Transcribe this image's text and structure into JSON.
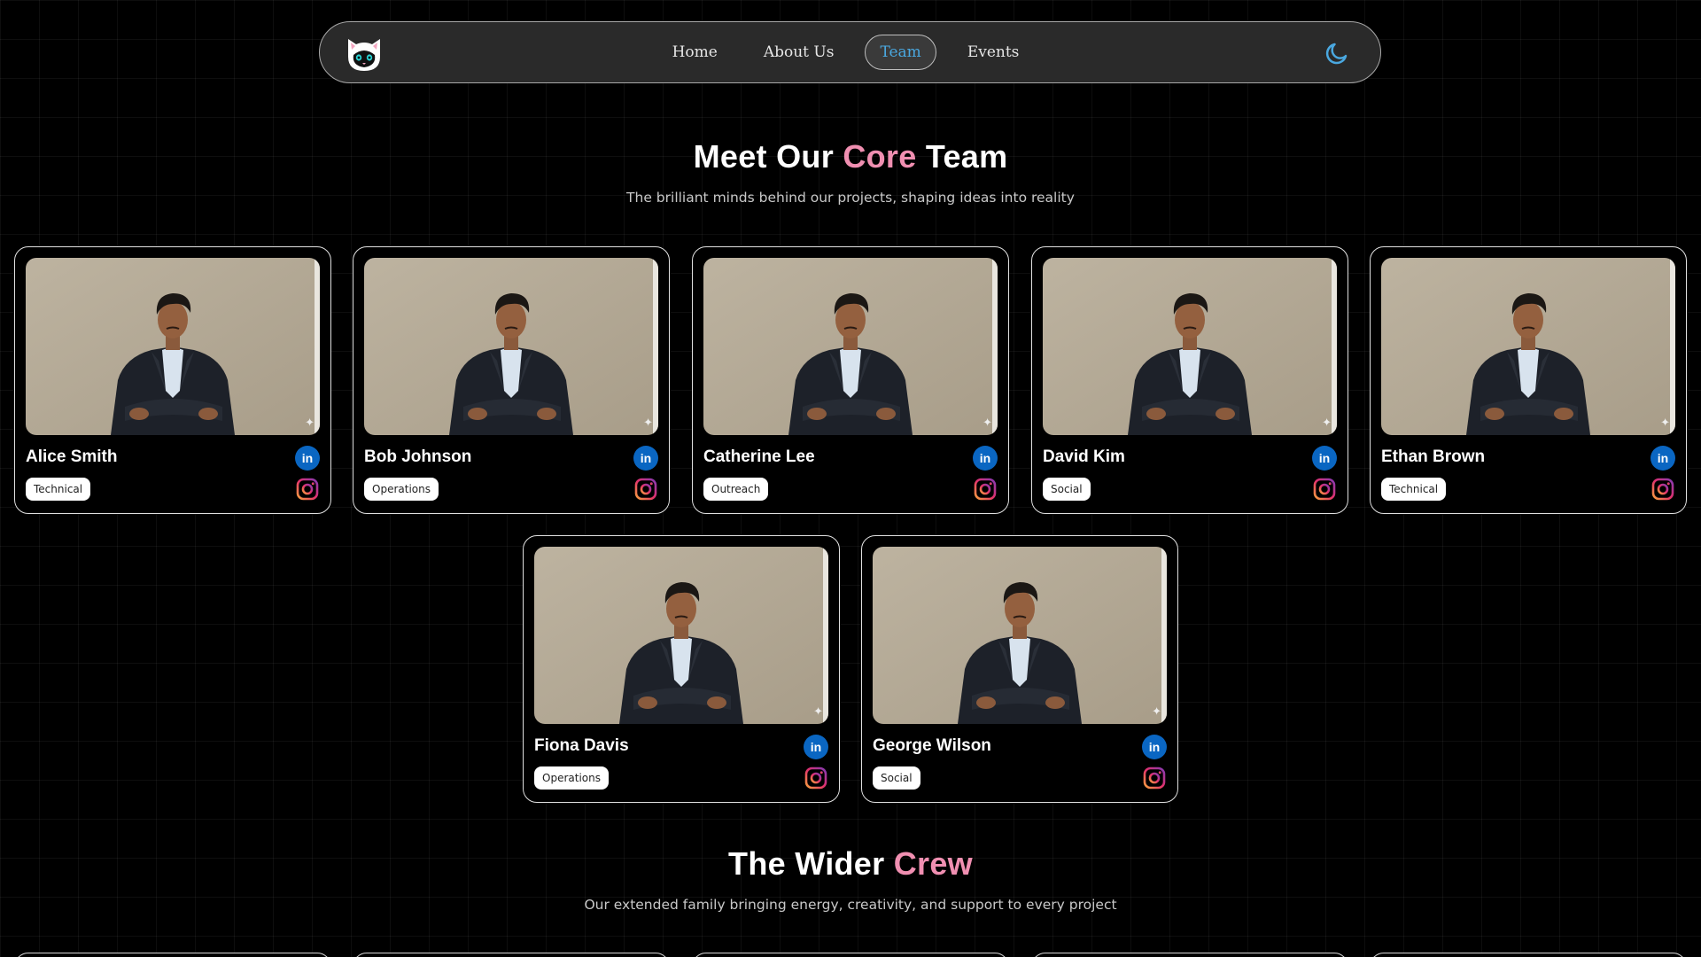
{
  "nav": {
    "logo_name": "cat-logo",
    "links": [
      {
        "label": "Home",
        "active": false
      },
      {
        "label": "About Us",
        "active": false
      },
      {
        "label": "Team",
        "active": true
      },
      {
        "label": "Events",
        "active": false
      }
    ],
    "theme_icon": "moon-icon"
  },
  "core": {
    "title_pre": "Meet Our ",
    "title_accent": "Core",
    "title_post": " Team",
    "subtitle": "The brilliant minds behind our projects, shaping ideas into reality"
  },
  "members": [
    {
      "name": "Alice Smith",
      "role": "Technical"
    },
    {
      "name": "Bob Johnson",
      "role": "Operations"
    },
    {
      "name": "Catherine Lee",
      "role": "Outreach"
    },
    {
      "name": "David Kim",
      "role": "Social"
    },
    {
      "name": "Ethan Brown",
      "role": "Technical"
    },
    {
      "name": "Fiona Davis",
      "role": "Operations"
    },
    {
      "name": "George Wilson",
      "role": "Social"
    }
  ],
  "crew": {
    "title_pre": "The Wider ",
    "title_accent": "Crew",
    "subtitle": "Our extended family bringing energy, creativity, and support to every project"
  },
  "colors": {
    "accent_pink": "#f08fb1",
    "active_link": "#4aa8e0",
    "linkedin_blue": "#0a66c2"
  }
}
